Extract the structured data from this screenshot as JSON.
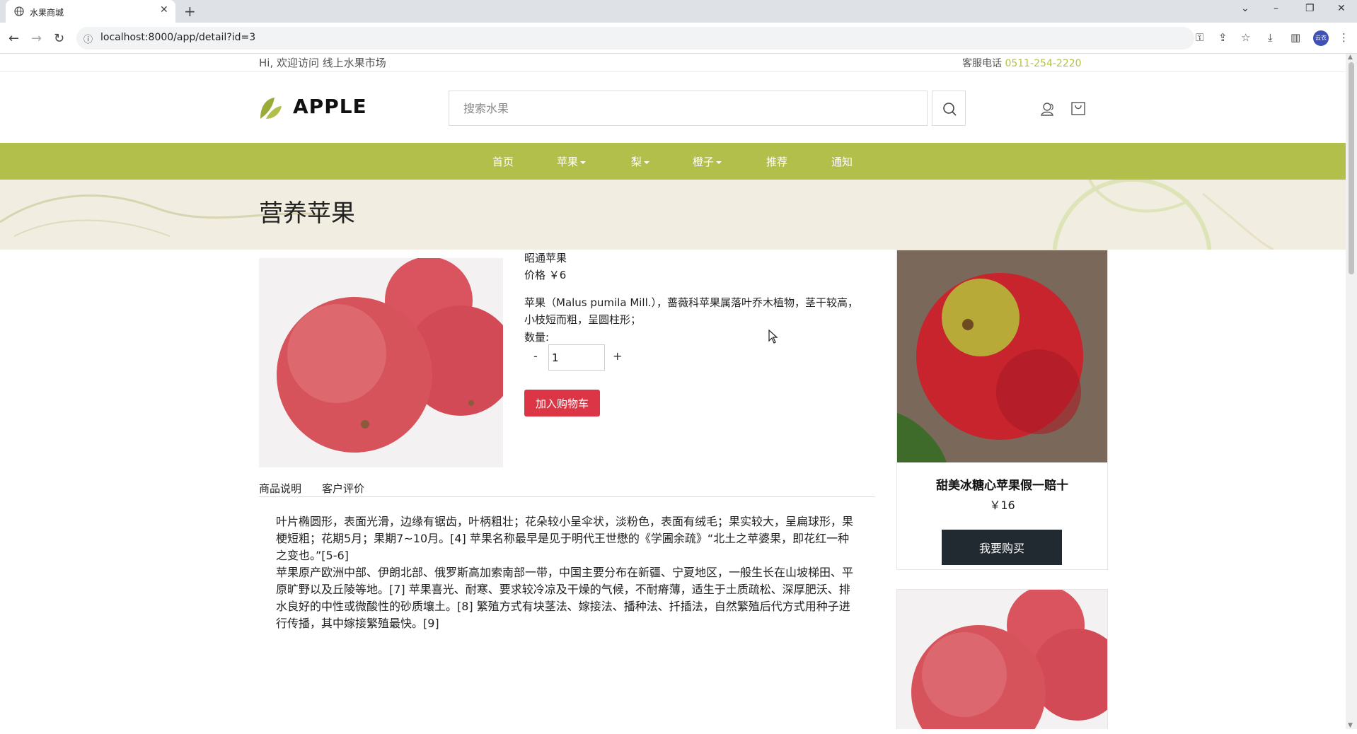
{
  "browser": {
    "tab_title": "水果商城",
    "tab_close": "✕",
    "new_tab": "+",
    "url": "localhost:8000/app/detail?id=3",
    "profile": "云衣"
  },
  "topbar": {
    "welcome": "Hi, 欢迎访问 线上水果市场",
    "service_label": "客服电话",
    "phone": "0511-254-2220"
  },
  "header": {
    "logo": "APPLE",
    "search_placeholder": "搜索水果"
  },
  "nav": {
    "items": [
      "首页",
      "苹果",
      "梨",
      "橙子",
      "推荐",
      "通知"
    ]
  },
  "banner": {
    "title": "营养苹果"
  },
  "product": {
    "name": "昭通苹果",
    "price": "价格 ￥6",
    "description": "苹果（Malus pumila Mill.），蔷薇科苹果属落叶乔木植物，茎干较高，小枝短而粗，呈圆柱形；",
    "qty_label": "数量:",
    "qty_minus": "-",
    "qty_value": "1",
    "qty_plus": "+",
    "add_to_cart": "加入购物车"
  },
  "tabs": [
    "商品说明",
    "客户评价"
  ],
  "content": {
    "para1": "叶片椭圆形，表面光滑，边缘有锯齿，叶柄粗壮；花朵较小呈伞状，淡粉色，表面有绒毛；果实较大，呈扁球形，果梗短粗；花期5月；果期7~10月。[4] 苹果名称最早是见于明代王世懋的《学圃余疏》“北土之苹婆果，即花红一种之变也。”[5-6]",
    "para2": "苹果原产欧洲中部、伊朗北部、俄罗斯高加索南部一带，中国主要分布在新疆、宁夏地区，一般生长在山坡梯田、平原旷野以及丘陵等地。[7] 苹果喜光、耐寒、要求较冷凉及干燥的气候，不耐瘠薄，适生于土质疏松、深厚肥沃、排水良好的中性或微酸性的砂质壤土。[8] 繁殖方式有块茎法、嫁接法、播种法、扦插法，自然繁殖后代方式用种子进行传播，其中嫁接繁殖最快。[9]"
  },
  "sidebar": {
    "card1_name": "甜美冰糖心苹果假一赔十",
    "card1_price": "￥16",
    "card1_buy": "我要购买"
  },
  "colors": {
    "accent": "#b3bf4b",
    "cart_button": "#dc3545",
    "buy_button": "#222a31",
    "banner_bg": "#f2ede1"
  }
}
